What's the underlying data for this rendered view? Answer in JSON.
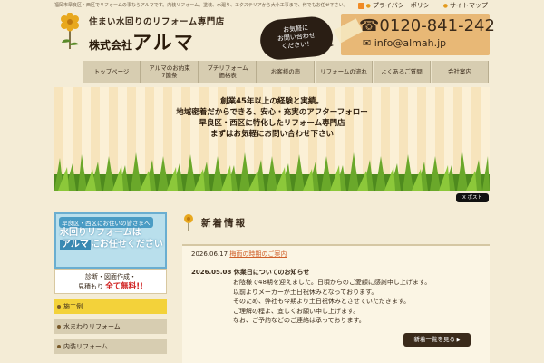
{
  "header": {
    "top_caption": "福岡市早良区・西区でリフォームの事ならアルマです。内装リフォーム、塗装、水廻り、エクステリアから大小工事まで、何でもお任せ下さい。",
    "links": [
      {
        "label": "プライバシーポリシー"
      },
      {
        "label": "サイトマップ"
      }
    ],
    "tagline": "住まい水回りのリフォーム専門店",
    "company_prefix": "株式会社",
    "company_name": "アルマ",
    "bubble_text": "お気軽に\nお問い合わせ\nください！",
    "phone": "0120-841-242",
    "email": "info@almah.jp"
  },
  "nav": [
    "トップページ",
    "アルマのお約束\n7箇条",
    "プチリフォーム\n価格表",
    "お客様の声",
    "リフォームの流れ",
    "よくあるご質問",
    "会社案内"
  ],
  "hero": {
    "lines": [
      "創業45年以上の経験と実績。",
      "地域密着だからできる、安心・充実のアフターフォロー",
      "早良区・西区に特化したリフォーム専門店",
      "まずはお気軽にお問い合わせ下さい"
    ]
  },
  "share_button": "X ポスト",
  "sidebar": {
    "banner_top": "早良区・西区にお住いの皆さまへ",
    "banner_line1": "水回りリフォームは",
    "banner_line2_hl": "アルマ",
    "banner_line2_rest": "にお任せください",
    "banner_sub1": "診断・図面作成・",
    "banner_sub2": "見積もり",
    "banner_sub_free": "全て無料!!",
    "items": [
      "施工例",
      "水まわりリフォーム",
      "内装リフォーム"
    ]
  },
  "news": {
    "title": "新着情報",
    "item1_date": "2026.06.17",
    "item1_title": "梅雨の時期のご案内",
    "item2_date": "2026.05.08",
    "item2_title": "休業日についてのお知らせ",
    "item2_lines": [
      "お陰様で48期を迎えました。日頃からのご愛顧に感謝申し上げます。",
      "以前よりメーカーが土日祝休みとなっております。",
      "そのため、弊社も今期より土日祝休みとさせていただきます。",
      "ご理解の程よ、宜しくお願い申し上げます。",
      "なお、ご予約などのご連絡は承っております。"
    ],
    "more_label": "新着一覧を見る"
  }
}
